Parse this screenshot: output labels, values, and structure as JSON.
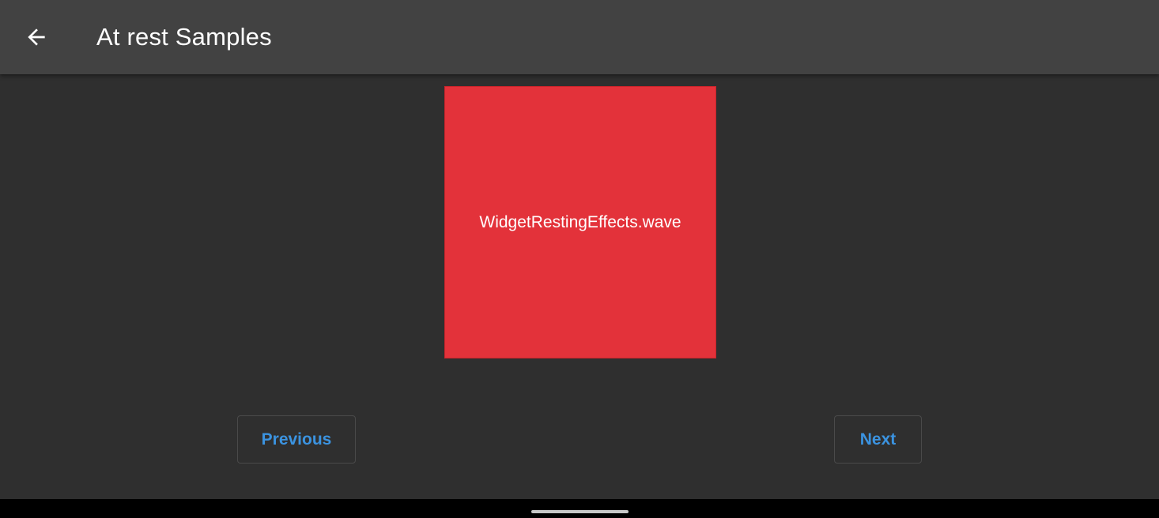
{
  "app_bar": {
    "title": "At rest Samples",
    "back_icon": "arrow-back-icon"
  },
  "sample": {
    "label": "WidgetRestingEffects.wave",
    "color": "#e3323a"
  },
  "controls": {
    "previous_label": "Previous",
    "next_label": "Next",
    "accent_color": "#3b93e0"
  },
  "theme": {
    "app_bar_color": "#424242",
    "background_color": "#2f2f2f",
    "title_color": "#ffffff"
  }
}
